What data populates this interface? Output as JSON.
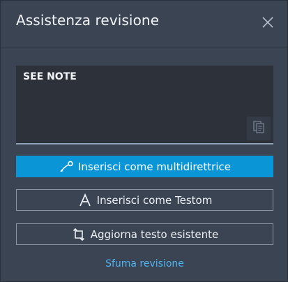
{
  "header": {
    "title": "Assistenza revisione"
  },
  "text_area": {
    "value": "SEE NOTE"
  },
  "buttons": {
    "insert_multileader": "Inserisci come multidirettrice",
    "insert_text": "Inserisci come Testom",
    "update_text": "Aggiorna testo esistente"
  },
  "link": {
    "dismiss": "Sfuma revisione"
  },
  "icons": {
    "close": "close-icon",
    "copy": "copy-icon",
    "multileader": "multileader-icon",
    "text": "text-icon",
    "update": "update-icon"
  },
  "colors": {
    "panel": "#3b4453",
    "primary": "#0a96d6",
    "link": "#4fb4ef"
  }
}
